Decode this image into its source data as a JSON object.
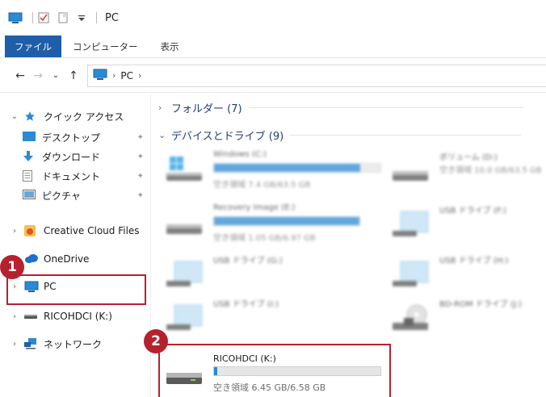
{
  "titlebar": {
    "title": "PC"
  },
  "ribbon": {
    "tabs": [
      "ファイル",
      "コンピューター",
      "表示"
    ]
  },
  "address": {
    "path_root": "PC"
  },
  "nav": {
    "quick_access": "クイック アクセス",
    "desktop": "デスクトップ",
    "downloads": "ダウンロード",
    "documents": "ドキュメント",
    "pictures": "ピクチャ",
    "creative_cloud": "Creative Cloud Files",
    "onedrive": "OneDrive",
    "pc": "PC",
    "ricoh": "RICOHDCI (K:)",
    "network": "ネットワーク"
  },
  "groups": {
    "folders": "フォルダー (7)",
    "devices": "デバイスとドライブ (9)"
  },
  "drives": [
    {
      "name": "Windows (C:)",
      "free": "空き領域 7.4 GB/63.5 GB",
      "fill": 0.88,
      "icon": "windows-drive-icon"
    },
    {
      "name": "ボリューム (D:)",
      "free": "空き領域 10.0 GB/63.5 GB",
      "fill": 0.0,
      "icon": "hdd-icon"
    },
    {
      "name": "Recovery Image (E:)",
      "free": "空き領域 1.05 GB/6.97 GB",
      "fill": 0.85,
      "icon": "hdd-icon"
    },
    {
      "name": "USB ドライブ (F:)",
      "icon": "usb-drive-icon"
    },
    {
      "name": "USB ドライブ (G:)",
      "icon": "usb-drive-icon"
    },
    {
      "name": "USB ドライブ (H:)",
      "icon": "usb-drive-icon"
    },
    {
      "name": "USB ドライブ (I:)",
      "icon": "usb-drive-icon"
    },
    {
      "name": "BD-ROM ドライブ (J:)",
      "icon": "bd-rom-icon"
    }
  ],
  "ricoh_drive": {
    "name": "RICOHDCI (K:)",
    "free": "空き領域 6.45 GB/6.58 GB",
    "fill": 0.02
  },
  "badges": [
    "1",
    "2"
  ],
  "colors": {
    "accent": "#1f5ea8",
    "highlight": "#b7202e",
    "bar": "#2a8ad4"
  }
}
